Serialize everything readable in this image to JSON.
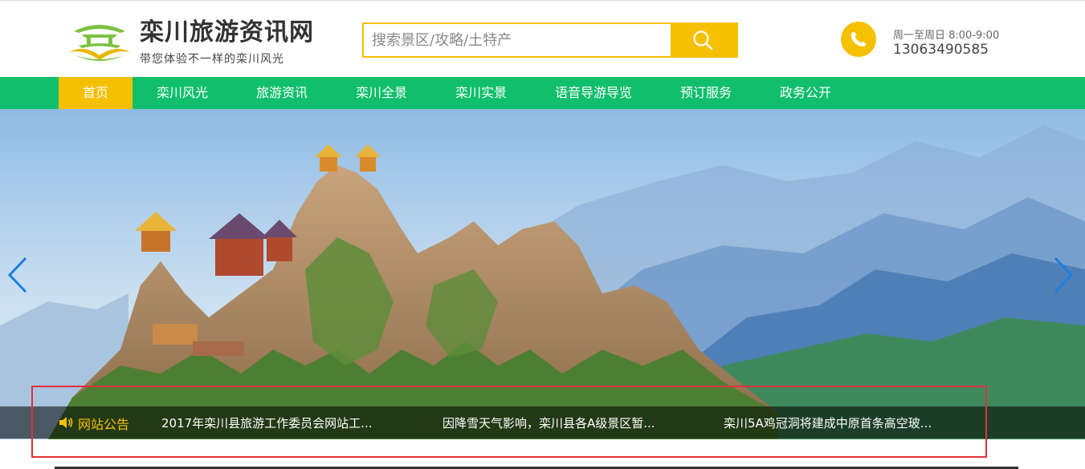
{
  "header": {
    "site_title": "栾川旅游资讯网",
    "slogan": "带您体验不一样的栾川风光",
    "search": {
      "placeholder": "搜索景区/攻略/土特产",
      "button_icon": "search-icon"
    },
    "contact": {
      "hours": "周一至周日 8:00-9:00",
      "phone": "13063490585",
      "icon": "phone-icon"
    }
  },
  "nav": {
    "items": [
      {
        "label": "首页",
        "active": true
      },
      {
        "label": "栾川风光"
      },
      {
        "label": "旅游资讯"
      },
      {
        "label": "栾川全景"
      },
      {
        "label": "栾川实景"
      },
      {
        "label": "语音导游导览"
      },
      {
        "label": "预订服务"
      },
      {
        "label": "政务公开"
      }
    ]
  },
  "banner": {
    "prev_icon": "chevron-left-icon",
    "next_icon": "chevron-right-icon",
    "notice": {
      "label": "网站公告",
      "items": [
        "2017年栾川县旅游工作委员会网站工...",
        "因降雪天气影响，栾川县各A级景区暂...",
        "栾川5A鸡冠洞将建成中原首条高空玻..."
      ]
    }
  },
  "colors": {
    "brand_green": "#10be6b",
    "accent_yellow": "#f5c000",
    "highlight_red": "#e0303c"
  }
}
